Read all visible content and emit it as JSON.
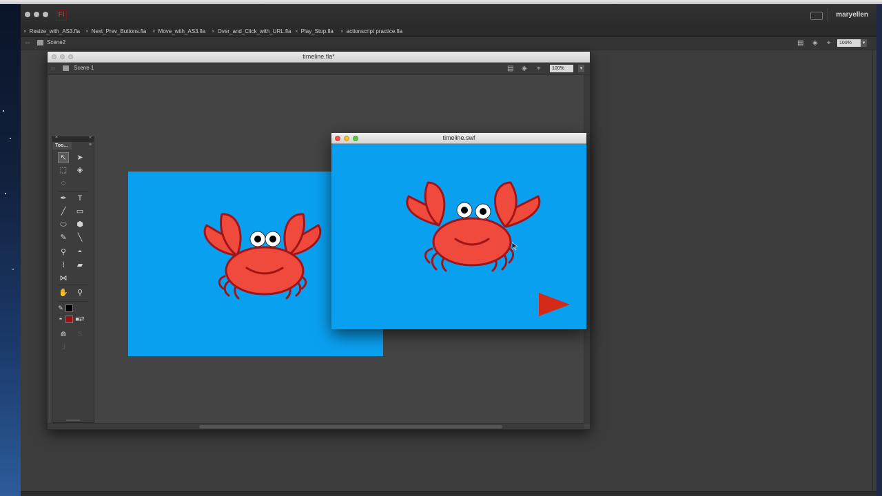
{
  "desktop": {
    "menubar_visible": true
  },
  "app": {
    "user_name": "maryellen",
    "document_tabs": [
      "Resize_with_AS3.fla",
      "Next_Prev_Buttons.fla",
      "Move_with_AS3.fla",
      "Over_and_Click_with_URL.fla",
      "Play_Stop.fla",
      "actionscript practice.fla"
    ],
    "scene_name": "Scene2",
    "zoom": "100%",
    "zoom_arrow": "▾"
  },
  "fla_window": {
    "title": "timeline.fla*",
    "scene_name": "Scene 1",
    "zoom": "100%",
    "zoom_arrow": "▾"
  },
  "tools_panel": {
    "tab_label": "Too...",
    "close_glyph": "×",
    "collapse_glyph": "«",
    "menu_glyph": "≡"
  },
  "swf_window": {
    "title": "timeline.swf"
  },
  "colors": {
    "stage": "#0aa0f0",
    "crab_body": "#ef4a3c",
    "crab_outline": "#a0141a",
    "play_arrow": "#d42a1a",
    "stroke_swatch": "#000000",
    "fill_swatch": "#9b1010"
  },
  "icons": {
    "scene": "clapper-icon",
    "edit_symbols": "symbol-icon",
    "center_stage": "crosshair-icon"
  }
}
